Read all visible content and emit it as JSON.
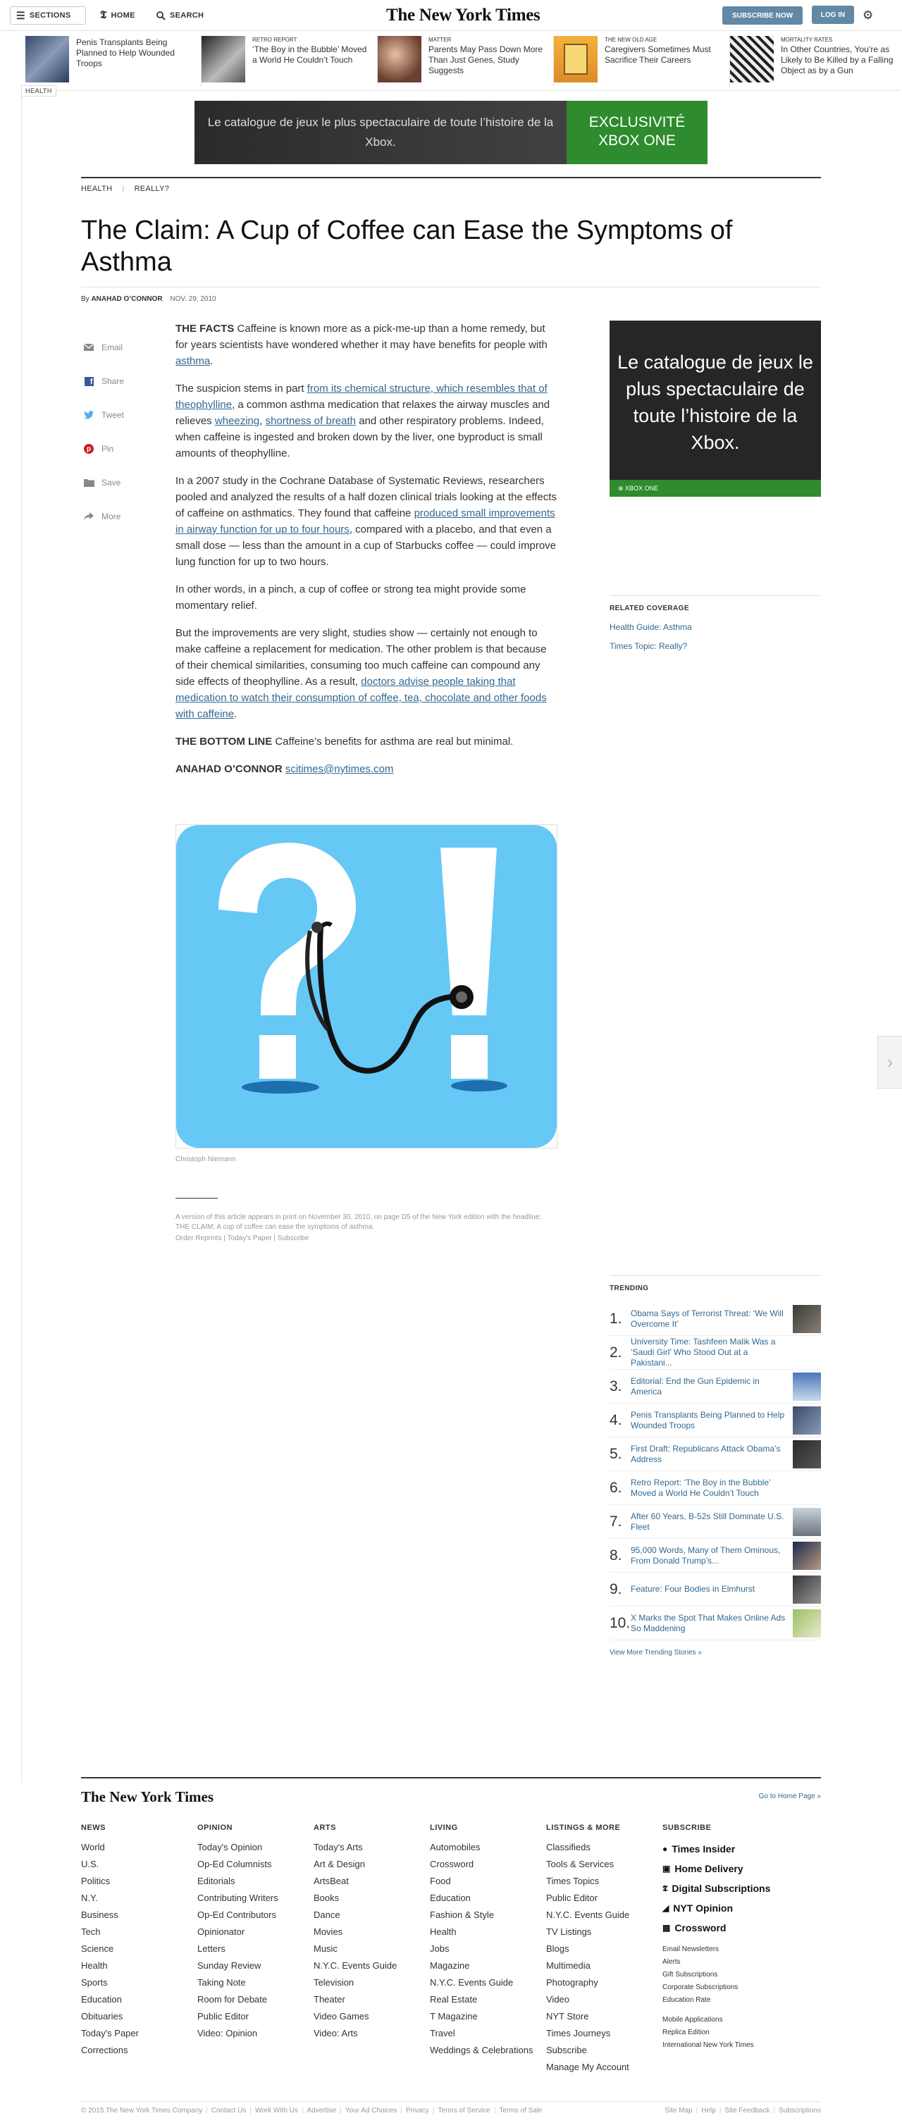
{
  "masthead": {
    "sections_label": "SECTIONS",
    "home_label": "HOME",
    "search_label": "SEARCH",
    "logo": "The New York Times",
    "subscribe_label": "SUBSCRIBE NOW",
    "login_label": "LOG IN"
  },
  "ribbon": [
    {
      "kicker": "",
      "title": "Penis Transplants Being Planned to Help Wounded Troops"
    },
    {
      "kicker": "RETRO REPORT",
      "title": "‘The Boy in the Bubble’ Moved a World He Couldn’t Touch"
    },
    {
      "kicker": "MATTER",
      "title": "Parents May Pass Down More Than Just Genes, Study Suggests"
    },
    {
      "kicker": "THE NEW OLD AGE",
      "title": "Caregivers Sometimes Must Sacrifice Their Careers"
    },
    {
      "kicker": "MORTALITY RATES",
      "title": "In Other Countries, You’re as Likely to Be Killed by a Falling Object as by a Gun"
    }
  ],
  "section_tag": "HEALTH",
  "top_ad": {
    "text": "Le catalogue de jeux le plus spectaculaire de toute l’histoire de la Xbox.",
    "badge": "EXCLUSIVITÉ XBOX ONE"
  },
  "kicker": {
    "section": "HEALTH",
    "column": "REALLY?"
  },
  "headline": "The Claim: A Cup of Coffee can Ease the Symptoms of Asthma",
  "byline": {
    "prefix": "By",
    "author": "ANAHAD O’CONNOR",
    "date": "NOV. 29, 2010"
  },
  "share": {
    "email": "Email",
    "share": "Share",
    "tweet": "Tweet",
    "pin": "Pin",
    "save": "Save",
    "more": "More"
  },
  "article": {
    "p1_lead": "THE FACTS",
    "p1_text": "Caffeine is known more as a pick-me-up than a home remedy, but for years scientists have wondered whether it may have benefits for people with",
    "p1_link": "asthma",
    "p2_a": "The suspicion stems in part",
    "p2_link1": "from its chemical structure, which resembles that of theophylline",
    "p2_b": ", a common asthma medication that relaxes the airway muscles and relieves",
    "p2_link2": "wheezing",
    "p2_link3": "shortness of breath",
    "p2_c": "and other respiratory problems. Indeed, when caffeine is ingested and broken down by the liver, one byproduct is small amounts of theophylline.",
    "p3_a": "In a 2007 study in the Cochrane Database of Systematic Reviews, researchers pooled and analyzed the results of a half dozen clinical trials looking at the effects of caffeine on asthmatics. They found that caffeine",
    "p3_link": "produced small improvements in airway function for up to four hours",
    "p3_b": ", compared with a placebo, and that even a small dose — less than the amount in a cup of Starbucks coffee — could improve lung function for up to two hours.",
    "p4": "In other words, in a pinch, a cup of coffee or strong tea might provide some momentary relief.",
    "p5_a": "But the improvements are very slight, studies show — certainly not enough to make caffeine a replacement for medication. The other problem is that because of their chemical similarities, consuming too much caffeine can compound any side effects of theophylline. As a result,",
    "p5_link": "doctors advise people taking that medication to watch their consumption of coffee, tea, chocolate and other foods with caffeine",
    "p6_lead": "THE BOTTOM LINE",
    "p6_text": "Caffeine’s benefits for asthma are real but minimal.",
    "sig_name": "ANAHAD O’CONNOR",
    "sig_email": "scitimes@nytimes.com"
  },
  "figure": {
    "credit": "Christoph Niemann"
  },
  "print_note": {
    "text": "A version of this article appears in print on November 30, 2010, on page D5 of the New York edition with the headline: THE CLAIM; A cup of coffee can ease the symptoms of asthma.",
    "reprints": "Order Reprints",
    "todays_paper": "Today's Paper",
    "subscribe": "Subscribe"
  },
  "side_ad": {
    "text": "Le catalogue de jeux le plus spectaculaire de toute l’histoire de la Xbox.",
    "bar": "XBOX ONE"
  },
  "related": {
    "heading": "RELATED COVERAGE",
    "links": [
      "Health Guide: Asthma",
      "Times Topic: Really?"
    ]
  },
  "trending": {
    "heading": "TRENDING",
    "items": [
      {
        "num": "1.",
        "title": "Obama Says of Terrorist Threat: ‘We Will Overcome It’"
      },
      {
        "num": "2.",
        "title": "University Time: Tashfeen Malik Was a ‘Saudi Girl’ Who Stood Out at a Pakistani..."
      },
      {
        "num": "3.",
        "title": "Editorial: End the Gun Epidemic in America"
      },
      {
        "num": "4.",
        "title": "Penis Transplants Being Planned to Help Wounded Troops"
      },
      {
        "num": "5.",
        "title": "First Draft: Republicans Attack Obama’s Address"
      },
      {
        "num": "6.",
        "title": "Retro Report: ‘The Boy in the Bubble’ Moved a World He Couldn’t Touch"
      },
      {
        "num": "7.",
        "title": "After 60 Years, B-52s Still Dominate U.S. Fleet"
      },
      {
        "num": "8.",
        "title": "95,000 Words, Many of Them Ominous, From Donald Trump’s..."
      },
      {
        "num": "9.",
        "title": "Feature: Four Bodies in Elmhurst"
      },
      {
        "num": "10.",
        "title": "X Marks the Spot That Makes Online Ads So Maddening"
      }
    ],
    "more": "View More Trending Stories »"
  },
  "footer": {
    "logo": "The New York Times",
    "home_link": "Go to Home Page »",
    "columns": [
      {
        "heading": "NEWS",
        "links": [
          "World",
          "U.S.",
          "Politics",
          "N.Y.",
          "Business",
          "Tech",
          "Science",
          "Health",
          "Sports",
          "Education",
          "Obituaries",
          "Today's Paper",
          "Corrections"
        ]
      },
      {
        "heading": "OPINION",
        "links": [
          "Today's Opinion",
          "Op-Ed Columnists",
          "Editorials",
          "Contributing Writers",
          "Op-Ed Contributors",
          "Opinionator",
          "Letters",
          "Sunday Review",
          "Taking Note",
          "Room for Debate",
          "Public Editor",
          "Video: Opinion"
        ]
      },
      {
        "heading": "ARTS",
        "links": [
          "Today's Arts",
          "Art & Design",
          "ArtsBeat",
          "Books",
          "Dance",
          "Movies",
          "Music",
          "N.Y.C. Events Guide",
          "Television",
          "Theater",
          "Video Games",
          "Video: Arts"
        ]
      },
      {
        "heading": "LIVING",
        "links": [
          "Automobiles",
          "Crossword",
          "Food",
          "Education",
          "Fashion & Style",
          "Health",
          "Jobs",
          "Magazine",
          "N.Y.C. Events Guide",
          "Real Estate",
          "T Magazine",
          "Travel",
          "Weddings & Celebrations"
        ]
      },
      {
        "heading": "LISTINGS & MORE",
        "links": [
          "Classifieds",
          "Tools & Services",
          "Times Topics",
          "Public Editor",
          "N.Y.C. Events Guide",
          "TV Listings",
          "Blogs",
          "Multimedia",
          "Photography",
          "Video",
          "NYT Store",
          "Times Journeys",
          "Subscribe",
          "Manage My Account"
        ]
      }
    ],
    "subscribe": {
      "heading": "SUBSCRIBE",
      "big": [
        "Times Insider",
        "Home Delivery",
        "Digital Subscriptions",
        "NYT Opinion",
        "Crossword"
      ],
      "small1": [
        "Email Newsletters",
        "Alerts",
        "Gift Subscriptions",
        "Corporate Subscriptions",
        "Education Rate"
      ],
      "small2": [
        "Mobile Applications",
        "Replica Edition",
        "International New York Times"
      ]
    }
  },
  "legal": {
    "left": [
      "© 2015 The New York Times Company",
      "Contact Us",
      "Work With Us",
      "Advertise",
      "Your Ad Choices",
      "Privacy",
      "Terms of Service",
      "Terms of Sale"
    ],
    "right": [
      "Site Map",
      "Help",
      "Site Feedback",
      "Subscriptions"
    ]
  }
}
